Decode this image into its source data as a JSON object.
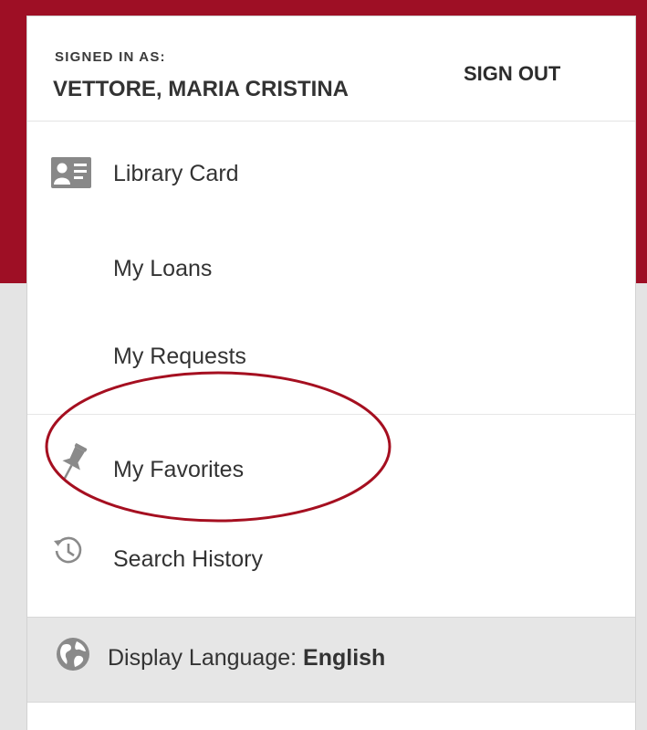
{
  "account": {
    "signed_in_label": "SIGNED IN AS:",
    "user_name": "VETTORE, MARIA CRISTINA",
    "sign_out_label": "SIGN OUT"
  },
  "menu": {
    "library_card": {
      "label": "Library Card",
      "icon": "id-card-icon"
    },
    "loans": {
      "label": "My Loans"
    },
    "requests": {
      "label": "My Requests"
    },
    "favorites": {
      "label": "My Favorites",
      "icon": "pin-icon"
    },
    "search_history": {
      "label": "Search History",
      "icon": "history-icon"
    }
  },
  "language": {
    "prefix": "Display Language: ",
    "value": "English",
    "icon": "globe-icon"
  },
  "colors": {
    "brand": "#9e0f25",
    "annotation": "#a50f20"
  }
}
